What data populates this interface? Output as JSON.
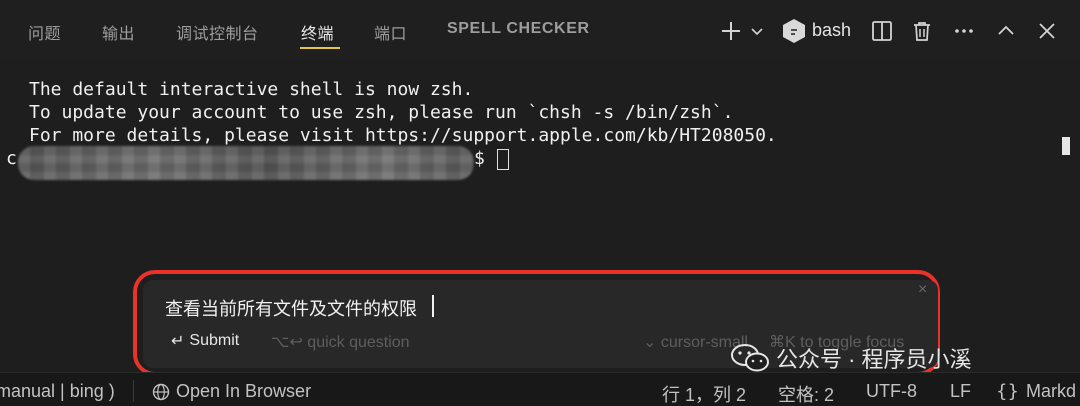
{
  "tabs": {
    "problems": "问题",
    "output": "输出",
    "debug_console": "调试控制台",
    "terminal": "终端",
    "ports": "端口",
    "spell_checker": "SPELL CHECKER"
  },
  "terminal_actions": {
    "shell_name": "bash"
  },
  "terminal": {
    "lines": [
      "The default interactive shell is now zsh.",
      "To update your account to use zsh, please run `chsh -s /bin/zsh`.",
      "For more details, please visit https://support.apple.com/kb/HT208050."
    ],
    "prompt_prefix": "c",
    "prompt_symbol": "$"
  },
  "quick_question": {
    "input_text": "查看当前所有文件及文件的权限",
    "close": "×",
    "submit_label": "Submit",
    "submit_glyph": "↵",
    "quick_question_hint": "⌥↩ quick question",
    "model_label": "cursor-small",
    "model_chevron": "⌄",
    "toggle_hint": "⌘K to toggle focus"
  },
  "watermark": {
    "text": "公众号 · 程序员小溪"
  },
  "statusbar": {
    "left_item": "manual | bing )",
    "open_in_browser": "Open In Browser",
    "cursor_position": "行 1，列 2",
    "indent": "空格: 2",
    "encoding": "UTF-8",
    "eol": "LF",
    "language_braces": "{}",
    "language": "Markd"
  },
  "colors": {
    "background": "#1e1e1e",
    "active_tab_underline": "#e7c547",
    "highlight_outline": "#e8322a"
  }
}
